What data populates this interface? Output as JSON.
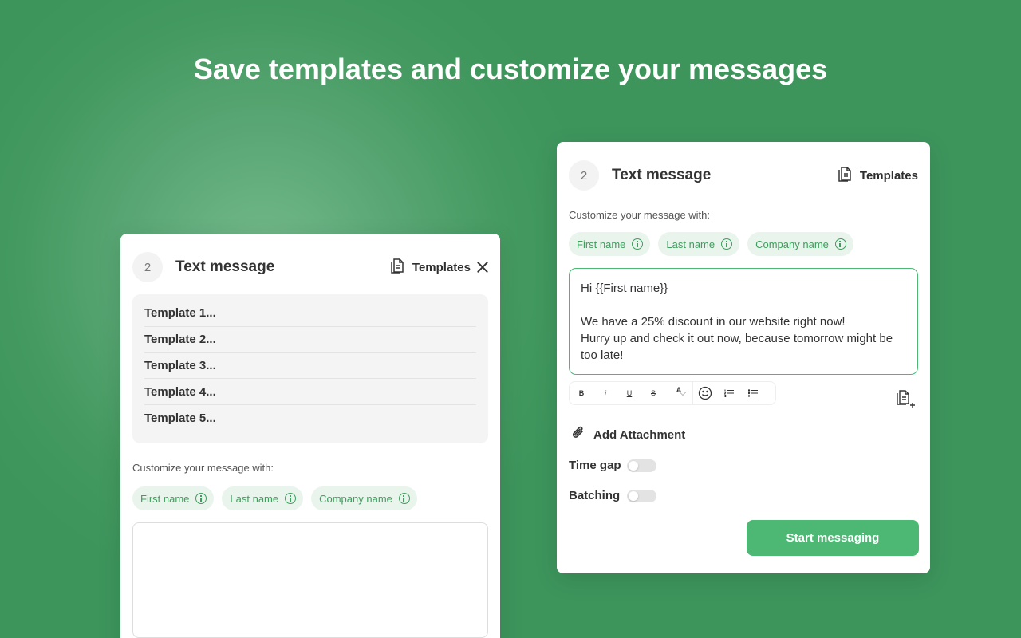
{
  "headline": "Save templates and customize your messages",
  "left_card": {
    "step": "2",
    "title": "Text message",
    "templates_label": "Templates",
    "templates": [
      "Template 1...",
      "Template 2...",
      "Template 3...",
      "Template 4...",
      "Template 5..."
    ],
    "customize_label": "Customize your message with:",
    "chips": [
      "First name",
      "Last name",
      "Company name"
    ],
    "message": ""
  },
  "right_card": {
    "step": "2",
    "title": "Text message",
    "templates_label": "Templates",
    "customize_label": "Customize your message with:",
    "chips": [
      "First name",
      "Last name",
      "Company name"
    ],
    "message": "Hi {{First name}}\n\nWe have a 25% discount in our website right now!\nHurry up and check it out now, because tomorrow might be too late!",
    "format_buttons": [
      "B",
      "i",
      "U",
      "S",
      "A"
    ],
    "attachment_label": "Add Attachment",
    "toggles": [
      {
        "label": "Time gap",
        "on": false
      },
      {
        "label": "Batching",
        "on": false
      }
    ],
    "start_button": "Start messaging"
  },
  "colors": {
    "background": "#43995f",
    "accent": "#4cb874",
    "chip_bg": "#e9f4ec",
    "chip_text": "#3e9e5d"
  }
}
